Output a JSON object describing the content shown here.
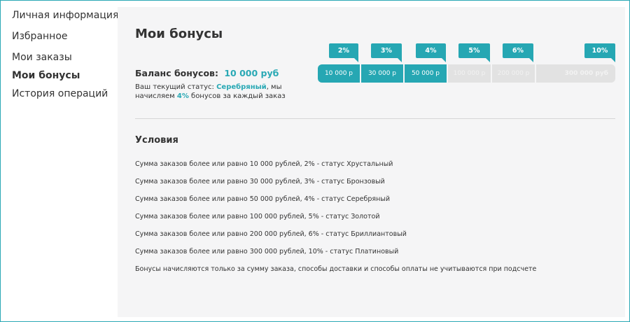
{
  "sidebar": {
    "items": [
      {
        "label": "Личная информация",
        "active": false
      },
      {
        "label": "Избранное",
        "active": false
      },
      {
        "label": "Мои заказы",
        "active": false
      },
      {
        "label": "Мои бонусы",
        "active": true
      },
      {
        "label": "История операций",
        "active": false
      }
    ]
  },
  "main": {
    "title": "Мои бонусы",
    "balance_label": "Баланс бонусов:",
    "balance_value": "10 000 руб",
    "status_prefix": "Ваш текущий статус: ",
    "status_name": "Серебряный",
    "status_mid": ", мы начисляем ",
    "status_percent": "4%",
    "status_suffix": " бонусов за каждый заказ"
  },
  "scale": {
    "tiers": [
      {
        "percent": "2%",
        "threshold": "10 000 р",
        "reached": true
      },
      {
        "percent": "3%",
        "threshold": "30 000 р",
        "reached": true
      },
      {
        "percent": "4%",
        "threshold": "50 000 р",
        "reached": true
      },
      {
        "percent": "5%",
        "threshold": "100 000 р",
        "reached": false
      },
      {
        "percent": "6%",
        "threshold": "200 000 р",
        "reached": false
      },
      {
        "percent": "10%",
        "threshold": "300 000 руб",
        "reached": false
      }
    ],
    "colors": {
      "active": "#26a7b3",
      "inactive": "#e2e2e2"
    }
  },
  "conditions": {
    "title": "Условия",
    "items": [
      "Сумма заказов более или равно 10 000 рублей, 2% - статус Хрустальный",
      "Сумма заказов более или равно 30 000 рублей, 3% - статус Бронзовый",
      "Сумма заказов более или равно 50 000 рублей, 4% - статус Серебряный",
      "Сумма заказов более или равно 100 000 рублей, 5% - статус Золотой",
      "Сумма заказов более или равно 200 000 рублей, 6% - статус Бриллиантовый",
      "Сумма заказов более или равно 300 000 рублей, 10%  - статус Платиновый",
      "Бонусы начисляются только за сумму заказа, способы доставки и способы оплаты не учитываются при подсчете"
    ]
  }
}
